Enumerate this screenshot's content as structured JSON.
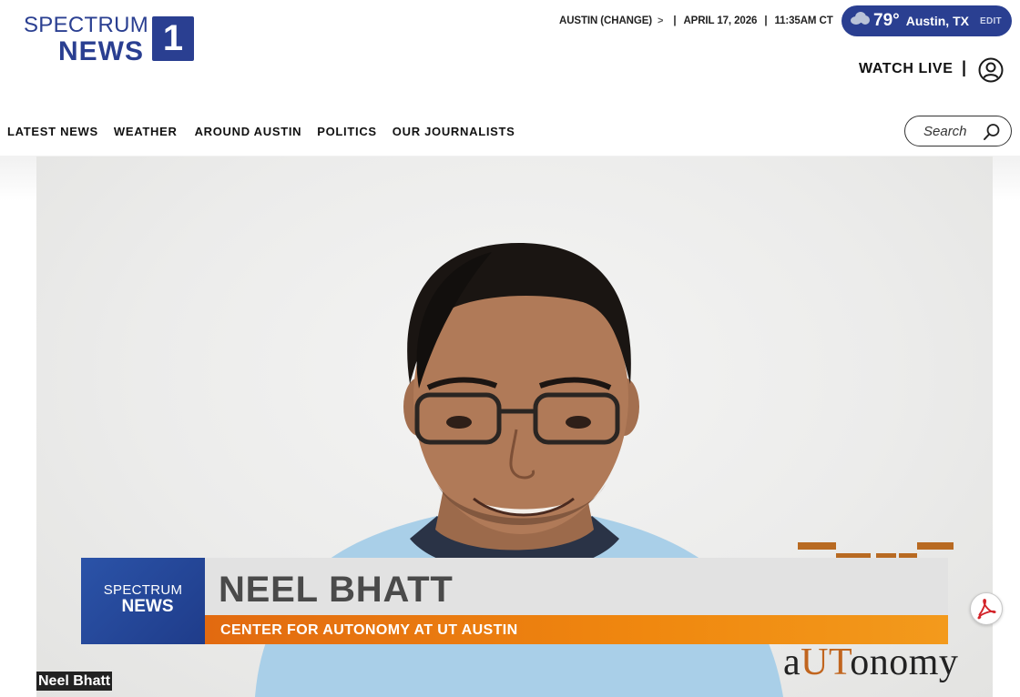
{
  "brand": {
    "logo_line1": "SPECTRUM",
    "logo_line2": "NEWS",
    "logo_number": "1",
    "color": "#2a3f91"
  },
  "topbar": {
    "location": "AUSTIN (CHANGE)",
    "chevron": ">",
    "separator": "|",
    "date": "APRIL 17, 2026",
    "time": "11:35AM CT"
  },
  "weather": {
    "icon": "cloud-icon",
    "temperature": "79°",
    "location": "Austin, TX",
    "edit_label": "EDIT"
  },
  "header": {
    "watch_live": "WATCH LIVE",
    "separator": "|",
    "user_icon": "user-icon"
  },
  "nav": {
    "items": [
      "LATEST NEWS",
      "WEATHER",
      "AROUND AUSTIN",
      "POLITICS",
      "OUR JOURNALISTS"
    ]
  },
  "search": {
    "placeholder": "Search",
    "icon": "search-icon"
  },
  "video": {
    "lower_third": {
      "badge_line1": "SPECTRUM",
      "badge_line2": "NEWS",
      "name": "NEEL BHATT",
      "title": "CENTER FOR AUTONOMY AT UT AUSTIN",
      "accent": "#f0880f"
    },
    "logo": {
      "part1": "a",
      "part2": "UT",
      "part3": "onomy"
    },
    "caption": "Neel Bhatt"
  },
  "floating": {
    "pdf_icon": "pdf-icon"
  }
}
